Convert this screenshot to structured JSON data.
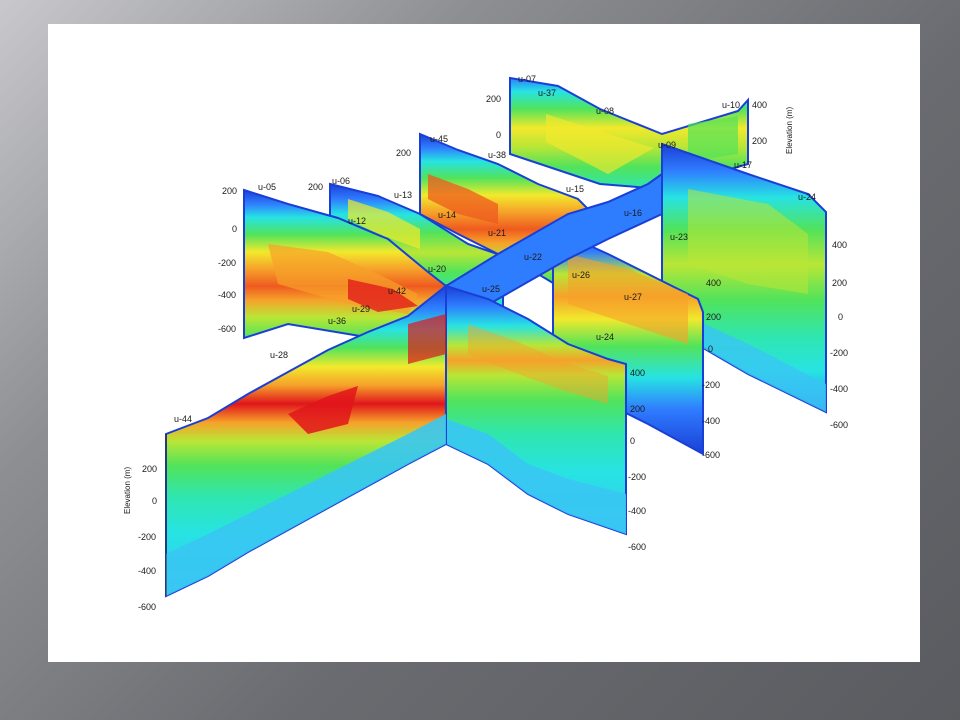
{
  "figure": {
    "colors": {
      "deep_blue": "#1a3fd6",
      "blue": "#2f7dff",
      "light_blue": "#39c6f2",
      "cyan": "#27e3e3",
      "aqua_green": "#2fe6b0",
      "green": "#52e35a",
      "yellow_green": "#b9e636",
      "yellow": "#f2e92c",
      "orange": "#f6a12a",
      "red_orange": "#ef5a1f",
      "red": "#e0151b"
    },
    "axis_title_left": "Elevation (m)",
    "axis_title_right": "Elevation (m)",
    "station_labels": [
      "u-44",
      "u-28",
      "u-36",
      "u-29",
      "u-42",
      "u-20",
      "u-25",
      "u-22",
      "u-21",
      "u-14",
      "u-13",
      "u-12",
      "u-05",
      "u-06",
      "u-45",
      "u-38",
      "u-07",
      "u-37",
      "u-08",
      "u-09",
      "u-10",
      "u-17",
      "u-15",
      "u-16",
      "u-23",
      "u-26",
      "u-27",
      "u-24",
      "u-24"
    ],
    "front_left_ticks": [
      "200",
      "0",
      "-200",
      "-400",
      "-600"
    ],
    "front_right_ticks": [
      "400",
      "200",
      "0",
      "-200",
      "-400",
      "-600"
    ],
    "left_panel_ticks": [
      "200",
      "0",
      "-200",
      "-400",
      "-600"
    ],
    "mid_panel_ticks": [
      "200"
    ],
    "back_panel_ticks": [
      "200",
      "0"
    ],
    "back_right_ticks": [
      "400",
      "200"
    ],
    "right_panel_ticks": [
      "400",
      "200",
      "0",
      "-200",
      "-400",
      "-600"
    ],
    "center_panel_ticks": [
      "400",
      "200",
      "0",
      "-200",
      "-400",
      "-600"
    ]
  }
}
